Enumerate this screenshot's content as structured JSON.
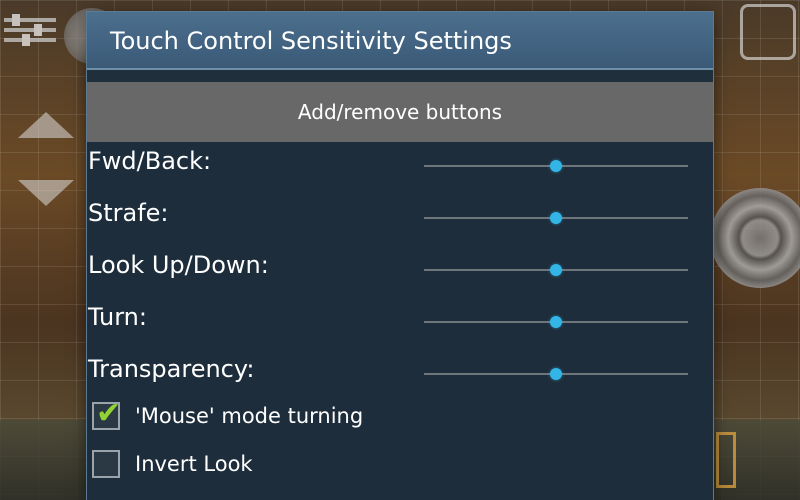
{
  "dialog": {
    "title": "Touch Control Sensitivity Settings",
    "add_remove_label": "Add/remove buttons"
  },
  "sliders": [
    {
      "label": "Fwd/Back:",
      "value": 0.5
    },
    {
      "label": "Strafe:",
      "value": 0.5
    },
    {
      "label": "Look Up/Down:",
      "value": 0.5
    },
    {
      "label": "Turn:",
      "value": 0.5
    },
    {
      "label": "Transparency:",
      "value": 0.5
    }
  ],
  "checkboxes": [
    {
      "label": "'Mouse' mode turning",
      "checked": true
    },
    {
      "label": "Invert Look",
      "checked": false
    }
  ],
  "colors": {
    "accent": "#33b5e5",
    "check": "#90d134",
    "title_bar": "#3a5a77",
    "dialog_bg": "#1d2d3b",
    "button_bg": "#686868"
  }
}
